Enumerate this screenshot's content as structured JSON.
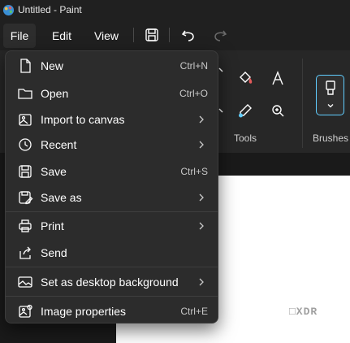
{
  "window": {
    "title": "Untitled - Paint"
  },
  "menubar": {
    "file": "File",
    "edit": "Edit",
    "view": "View"
  },
  "ribbon": {
    "tools_label": "Tools",
    "brushes_label": "Brushes"
  },
  "watermark": "□XDR",
  "file_menu": {
    "items": [
      {
        "label": "New",
        "shortcut": "Ctrl+N"
      },
      {
        "label": "Open",
        "shortcut": "Ctrl+O"
      },
      {
        "label": "Import to canvas",
        "shortcut": ""
      },
      {
        "label": "Recent",
        "shortcut": ""
      },
      {
        "label": "Save",
        "shortcut": "Ctrl+S"
      },
      {
        "label": "Save as",
        "shortcut": ""
      },
      {
        "label": "Print",
        "shortcut": ""
      },
      {
        "label": "Send",
        "shortcut": ""
      },
      {
        "label": "Set as desktop background",
        "shortcut": ""
      },
      {
        "label": "Image properties",
        "shortcut": "Ctrl+E"
      }
    ]
  },
  "colors": {
    "accent": "#60cdff",
    "menu_bg": "#2c2c2c",
    "app_bg": "#202020"
  }
}
